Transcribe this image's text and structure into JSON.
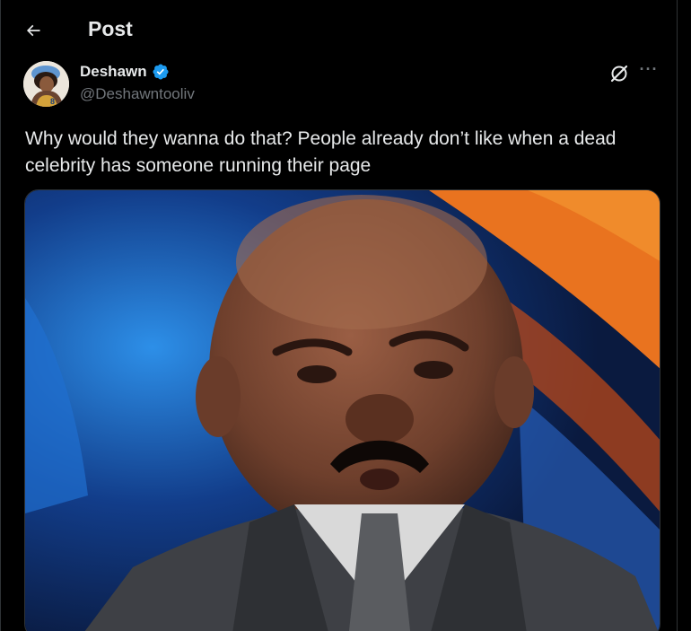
{
  "header": {
    "title": "Post",
    "back_icon": "arrow-left-icon"
  },
  "post": {
    "author_name": "Deshawn",
    "author_handle": "@Deshawntooliv",
    "verified": true,
    "text": "Why would they wanna do that? People already don’t like when a dead celebrity has someone running their page",
    "media_type": "image",
    "more_label": "···"
  },
  "colors": {
    "background": "#000000",
    "text": "#e7e9ea",
    "secondary": "#71767b",
    "verified": "#1d9bf0"
  }
}
